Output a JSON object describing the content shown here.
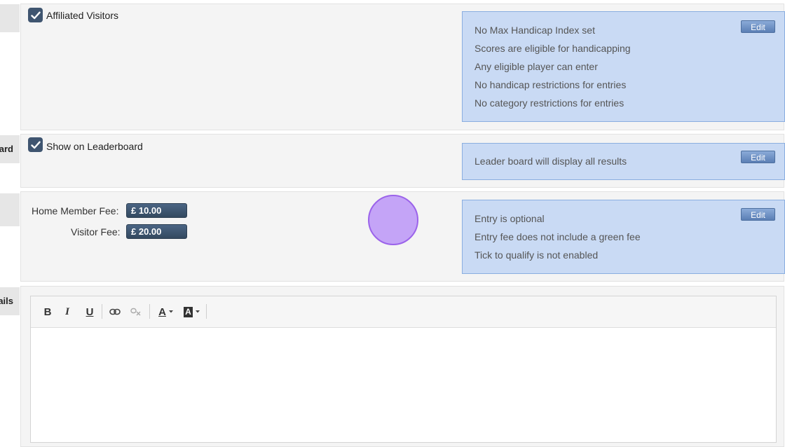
{
  "sections": {
    "visitors": {
      "checkbox_label": "Affiliated Visitors",
      "checked": true,
      "info_lines": [
        "No Max Handicap Index set",
        "Scores are eligible for handicapping",
        "Any eligible player can enter",
        "No handicap restrictions for entries",
        "No category restrictions for entries"
      ],
      "edit_label": "Edit"
    },
    "leaderboard": {
      "side_label": "ard",
      "checkbox_label": "Show on Leaderboard",
      "checked": true,
      "info_lines": [
        "Leader board will display all results"
      ],
      "edit_label": "Edit"
    },
    "fees": {
      "home_label": "Home Member Fee:",
      "home_value": "£ 10.00",
      "visitor_label": "Visitor Fee:",
      "visitor_value": "£ 20.00",
      "info_lines": [
        "Entry is optional",
        "Entry fee does not include a green fee",
        "Tick to qualify is not enabled"
      ],
      "edit_label": "Edit"
    },
    "details": {
      "side_label": "ails",
      "toolbar": {
        "bold": "B",
        "italic": "I",
        "underline": "U",
        "font_color": "A",
        "highlight": "A"
      }
    }
  },
  "icons": [
    "check-icon",
    "link-icon",
    "unlink-icon",
    "caret-down-icon"
  ],
  "colors": {
    "info_box": "#c9daf4",
    "fee_field": "#3f5570",
    "cursor_marker": "#c4a4f7"
  }
}
